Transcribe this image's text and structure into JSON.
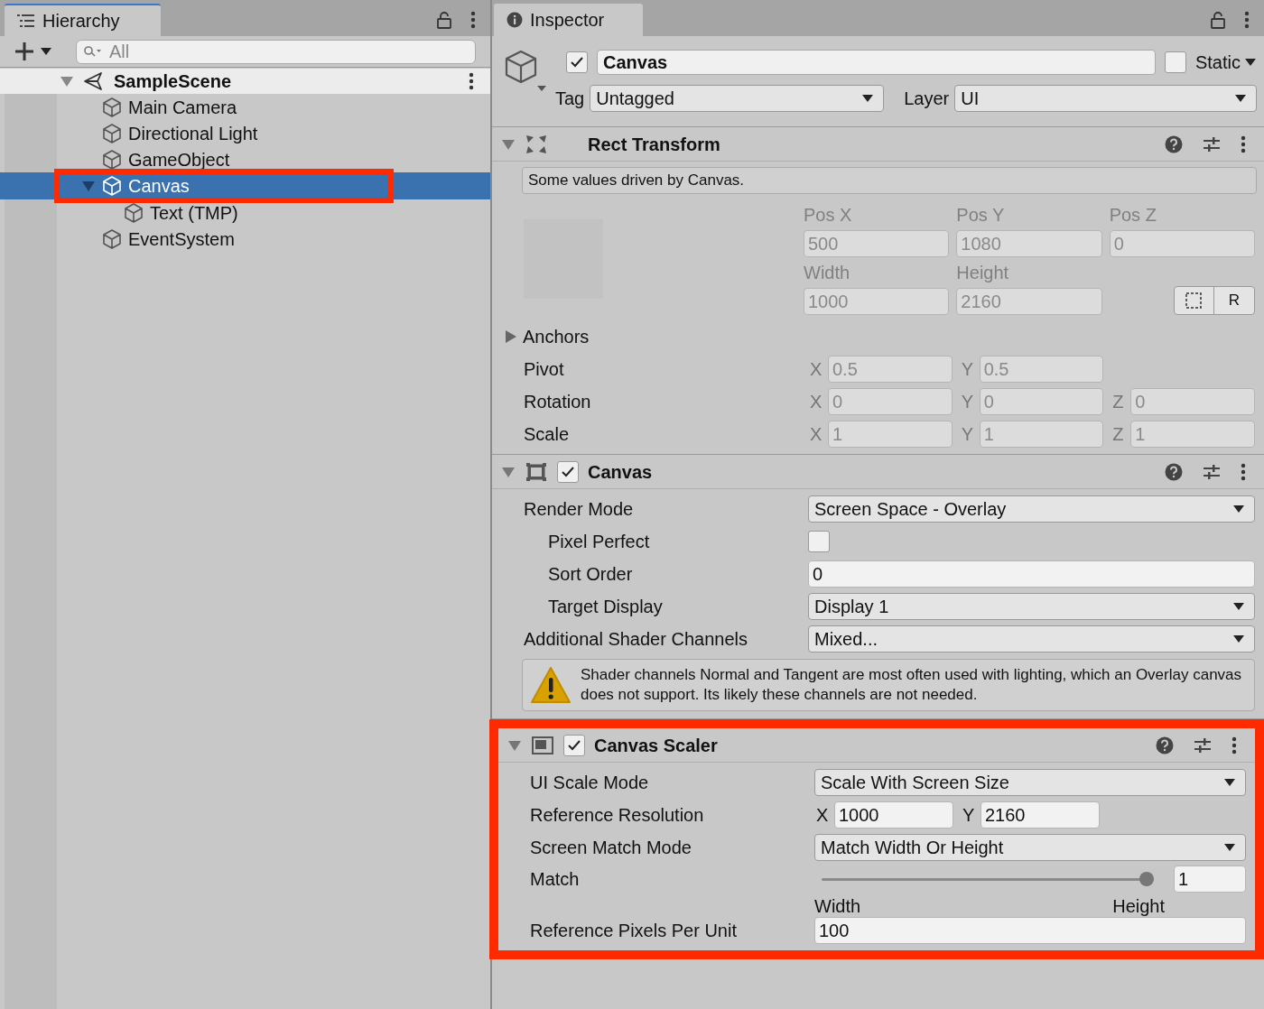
{
  "hierarchy": {
    "title": "Hierarchy",
    "search": {
      "placeholder": "All"
    },
    "scene": {
      "name": "SampleScene",
      "expanded": true
    },
    "items": [
      {
        "name": "Main Camera",
        "selected": false
      },
      {
        "name": "Directional Light",
        "selected": false
      },
      {
        "name": "GameObject",
        "selected": false
      },
      {
        "name": "Canvas",
        "selected": true,
        "annotated": true,
        "expanded": true,
        "children": [
          {
            "name": "Text (TMP)",
            "selected": false
          }
        ]
      },
      {
        "name": "EventSystem",
        "selected": false
      }
    ]
  },
  "inspector": {
    "title": "Inspector",
    "object": {
      "active": true,
      "name": "Canvas",
      "static": false,
      "static_label": "Static",
      "tag_label": "Tag",
      "tag": "Untagged",
      "layer_label": "Layer",
      "layer": "UI"
    },
    "components": [
      {
        "kind": "rect_transform",
        "title": "Rect Transform",
        "expanded": true,
        "note": "Some values driven by Canvas.",
        "grid": [
          {
            "label": "Pos X",
            "value": "500"
          },
          {
            "label": "Pos Y",
            "value": "1080"
          },
          {
            "label": "Pos Z",
            "value": "0"
          },
          {
            "label": "Width",
            "value": "1000"
          },
          {
            "label": "Height",
            "value": "2160"
          }
        ],
        "raw_button": "R",
        "rows": [
          {
            "kind": "foldout",
            "label": "Anchors",
            "expanded": false
          },
          {
            "kind": "vector",
            "label": "Pivot",
            "disabled": true,
            "axes": [
              {
                "axis": "X",
                "value": "0.5"
              },
              {
                "axis": "Y",
                "value": "0.5"
              }
            ]
          },
          {
            "kind": "vector",
            "label": "Rotation",
            "disabled": true,
            "axes": [
              {
                "axis": "X",
                "value": "0"
              },
              {
                "axis": "Y",
                "value": "0"
              },
              {
                "axis": "Z",
                "value": "0"
              }
            ]
          },
          {
            "kind": "vector",
            "label": "Scale",
            "disabled": true,
            "axes": [
              {
                "axis": "X",
                "value": "1"
              },
              {
                "axis": "Y",
                "value": "1"
              },
              {
                "axis": "Z",
                "value": "1"
              }
            ]
          }
        ]
      },
      {
        "kind": "canvas",
        "title": "Canvas",
        "expanded": true,
        "enabled": true,
        "rows": [
          {
            "kind": "dropdown",
            "label": "Render Mode",
            "value": "Screen Space - Overlay",
            "children": [
              {
                "kind": "checkbox",
                "label": "Pixel Perfect",
                "checked": false
              },
              {
                "kind": "number",
                "label": "Sort Order",
                "value": "0"
              },
              {
                "kind": "dropdown",
                "label": "Target Display",
                "value": "Display 1"
              }
            ]
          },
          {
            "kind": "dropdown",
            "label": "Additional Shader Channels",
            "value": "Mixed..."
          },
          {
            "kind": "warning",
            "text": "Shader channels Normal and Tangent are most often used with lighting, which an Overlay canvas does not support. Its likely these channels are not needed."
          }
        ]
      },
      {
        "kind": "canvas_scaler",
        "title": "Canvas Scaler",
        "expanded": true,
        "enabled": true,
        "annotated": true,
        "rows": [
          {
            "kind": "dropdown",
            "label": "UI Scale Mode",
            "value": "Scale With Screen Size"
          },
          {
            "kind": "vector",
            "label": "Reference Resolution",
            "disabled": false,
            "axes": [
              {
                "axis": "X",
                "value": "1000"
              },
              {
                "axis": "Y",
                "value": "2160"
              }
            ]
          },
          {
            "kind": "dropdown",
            "label": "Screen Match Mode",
            "value": "Match Width Or Height"
          },
          {
            "kind": "slider",
            "label": "Match",
            "level": 1,
            "value": "1",
            "min_label": "Width",
            "max_label": "Height"
          },
          {
            "kind": "number",
            "label": "Reference Pixels Per Unit",
            "value": "100"
          }
        ]
      }
    ]
  }
}
